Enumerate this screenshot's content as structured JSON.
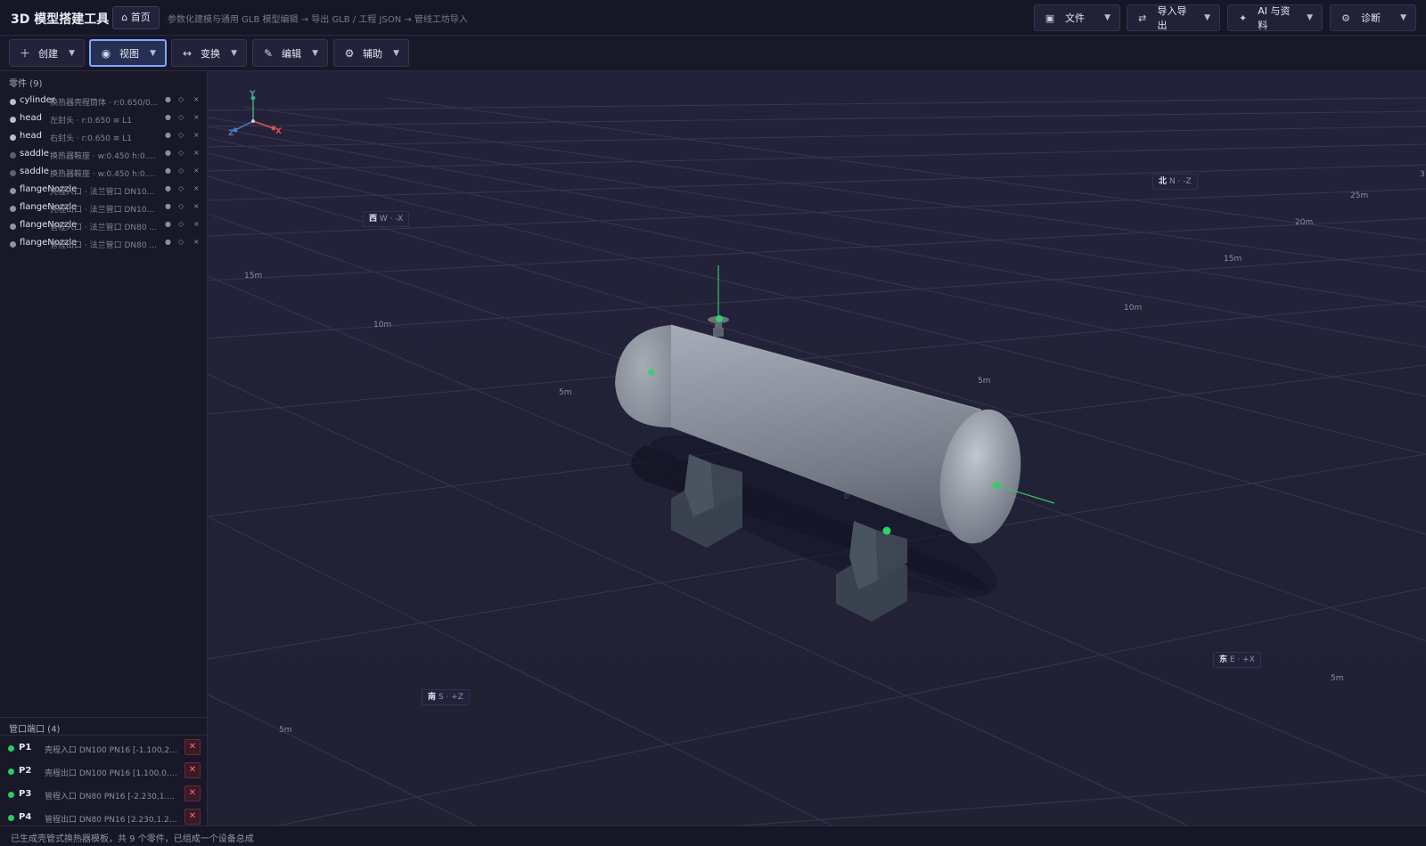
{
  "header": {
    "app_title": "3D 模型搭建工具",
    "home_label": "⌂ 首页",
    "subtitle": "参数化建模与通用 GLB 模型编辑 → 导出 GLB / 工程 JSON → 管线工坊导入",
    "menus": [
      {
        "label": "文件",
        "icon": "file-icon"
      },
      {
        "label": "导入导出",
        "icon": "swap-icon"
      },
      {
        "label": "AI 与资料",
        "icon": "sparkle-icon"
      },
      {
        "label": "诊断",
        "icon": "gear-icon"
      }
    ]
  },
  "toolbar": {
    "tools": [
      {
        "label": "创建",
        "icon": "plus-icon"
      },
      {
        "label": "视图",
        "icon": "view-icon",
        "active": true
      },
      {
        "label": "变换",
        "icon": "arrows-icon"
      },
      {
        "label": "编辑",
        "icon": "pencil-icon"
      },
      {
        "label": "辅助",
        "icon": "gear-icon"
      }
    ]
  },
  "parts": {
    "heading": "零件 (9)",
    "items": [
      {
        "name": "cylinder",
        "desc": "换热器壳程筒体 · r:0.650/0...",
        "color": "#b9bdcb"
      },
      {
        "name": "head",
        "desc": "左封头 · r:0.650 ≡ L1",
        "color": "#b9bdcb"
      },
      {
        "name": "head",
        "desc": "右封头 · r:0.650 ≡ L1",
        "color": "#b9bdcb"
      },
      {
        "name": "saddle",
        "desc": "换热器鞍座 · w:0.450 h:0.6...",
        "color": "#5b6170"
      },
      {
        "name": "saddle",
        "desc": "换热器鞍座 · w:0.450 h:0.6...",
        "color": "#5b6170"
      },
      {
        "name": "flangeNozzle",
        "desc": "壳程入口 · 法兰管口 DN100...",
        "color": "#8f94a3"
      },
      {
        "name": "flangeNozzle",
        "desc": "壳程出口 · 法兰管口 DN100...",
        "color": "#8f94a3"
      },
      {
        "name": "flangeNozzle",
        "desc": "管程入口 · 法兰管口 DN80 ...",
        "color": "#8f94a3"
      },
      {
        "name": "flangeNozzle",
        "desc": "管程出口 · 法兰管口 DN80 ...",
        "color": "#8f94a3"
      }
    ],
    "actions": {
      "visible": "●",
      "select": "◇",
      "delete": "×"
    }
  },
  "ports": {
    "heading": "管口端口 (4)",
    "items": [
      {
        "id": "P1",
        "desc": "壳程入口 DN100 PN16 [-1.100,2.10..."
      },
      {
        "id": "P2",
        "desc": "壳程出口 DN100 PN16 [1.100,0.39..."
      },
      {
        "id": "P3",
        "desc": "管程入口 DN80 PN16 [-2.230,1.25..."
      },
      {
        "id": "P4",
        "desc": "管程出口 DN80 PN16 [2.230,1.250..."
      }
    ],
    "delete_label": "✕"
  },
  "viewport": {
    "axes": {
      "x": "X",
      "y": "Y",
      "z": "Z"
    },
    "compass": {
      "north": {
        "main": "北",
        "rest": "N · -Z"
      },
      "west": {
        "main": "西",
        "rest": "W · -X"
      },
      "south": {
        "main": "南",
        "rest": "S · +Z"
      },
      "east": {
        "main": "东",
        "rest": "E · +X"
      }
    },
    "grid_labels": [
      "25m",
      "20m",
      "15m",
      "10m",
      "5m",
      "15m",
      "10m",
      "5m",
      "0",
      "5m",
      "5m",
      "3"
    ]
  },
  "status": {
    "text": "已生成壳管式换热器模板，共 9 个零件，已组成一个设备总成"
  }
}
